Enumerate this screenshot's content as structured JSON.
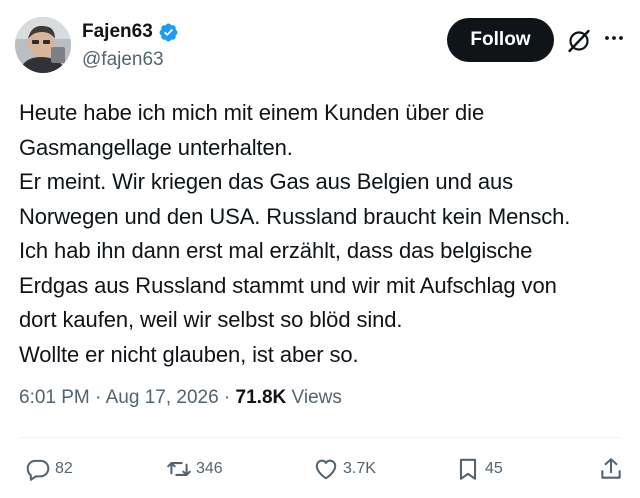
{
  "author": {
    "name": "Fajen63",
    "handle": "@fajen63",
    "verified_color": "#1d9bf0"
  },
  "header": {
    "follow_label": "Follow",
    "icons": [
      "grok-icon",
      "more-icon"
    ]
  },
  "tweet": {
    "lines": [
      "Heute habe ich mich mit einem Kunden über die",
      "Gasmangellage unterhalten.",
      "Er meint. Wir kriegen das Gas aus Belgien und aus",
      "Norwegen und den USA. Russland braucht kein Mensch.",
      "Ich hab ihn dann erst mal erzählt, dass das belgische",
      "Erdgas aus Russland stammt und wir mit Aufschlag von",
      "dort kaufen, weil wir selbst so blöd sind.",
      "Wollte er nicht glauben, ist aber so."
    ]
  },
  "meta": {
    "time": "6:01 PM",
    "separator": " · ",
    "date": "Aug 17, 2026",
    "views_count": "71.8K",
    "views_label": " Views"
  },
  "actions": {
    "replies": "82",
    "reposts": "346",
    "likes": "3.7K",
    "bookmarks": "45"
  },
  "colors": {
    "text": "#0f1419",
    "secondary": "#536471",
    "button_bg": "#0f1419",
    "divider": "#eff3f4"
  }
}
